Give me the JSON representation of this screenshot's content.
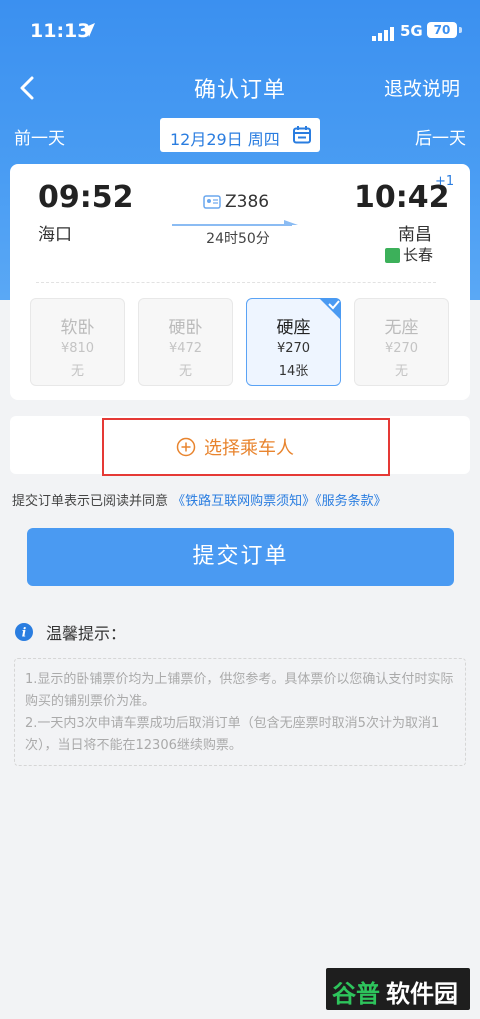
{
  "status": {
    "time": "11:13",
    "network": "5G",
    "battery": "70"
  },
  "nav": {
    "title": "确认订单",
    "right_link": "退改说明"
  },
  "date_bar": {
    "prev": "前一天",
    "date": "12月29日 周四",
    "next": "后一天"
  },
  "train": {
    "departure_time": "09:52",
    "departure_station": "海口",
    "train_number": "Z386",
    "duration": "24时50分",
    "arrival_time": "10:42",
    "arrival_day_offset": "+1",
    "arrival_station": "南昌",
    "transit_station": "长春"
  },
  "seats": [
    {
      "name": "软卧",
      "price": "¥810",
      "count": "无"
    },
    {
      "name": "硬卧",
      "price": "¥472",
      "count": "无"
    },
    {
      "name": "硬座",
      "price": "¥270",
      "count": "14张"
    },
    {
      "name": "无座",
      "price": "¥270",
      "count": "无"
    }
  ],
  "selected_seat_index": 2,
  "passenger": {
    "add_label": "选择乘车人"
  },
  "agreement": {
    "prefix": "提交订单表示已阅读并同意",
    "link1": "《铁路互联网购票须知》",
    "link2": "《服务条款》"
  },
  "submit_label": "提交订单",
  "tips": {
    "title": "温馨提示：",
    "line1": "1.显示的卧铺票价均为上铺票价，供您参考。具体票价以您确认支付时实际购买的铺别票价为准。",
    "line2": "2.一天内3次申请车票成功后取消订单（包含无座票时取消5次计为取消1次），当日将不能在12306继续购票。"
  },
  "watermark": {
    "part1": "谷普",
    "part2": "软件园"
  },
  "colors": {
    "primary": "#4a9af2",
    "accent_orange": "#e8842e",
    "highlight_red": "#e53935"
  },
  "icons": [
    "location-arrow-icon",
    "signal-icon",
    "back-chevron-icon",
    "calendar-icon",
    "train-id-icon",
    "arrow-right-icon",
    "transit-badge-icon",
    "check-corner-icon",
    "plus-circle-icon",
    "info-icon"
  ]
}
